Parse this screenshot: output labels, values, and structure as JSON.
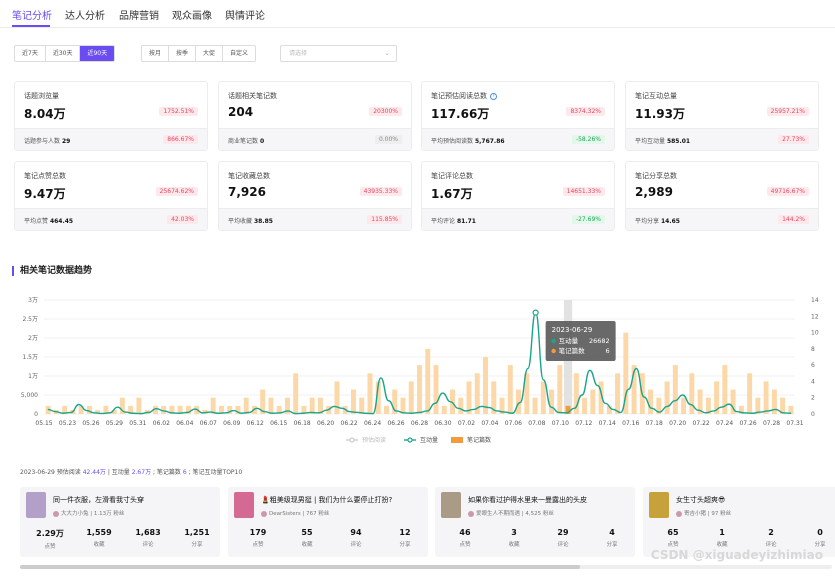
{
  "tabs": [
    {
      "label": "笔记分析",
      "active": true
    },
    {
      "label": "达人分析",
      "active": false
    },
    {
      "label": "品牌营销",
      "active": false
    },
    {
      "label": "观众画像",
      "active": false
    },
    {
      "label": "舆情评论",
      "active": false
    }
  ],
  "range_buttons": [
    "近7天",
    "近30天",
    "近90天"
  ],
  "range_selected": "近90天",
  "period_buttons": [
    "按月",
    "按季",
    "大促",
    "自定义"
  ],
  "select_placeholder": "请选择",
  "cards": [
    {
      "label": "话题浏览量",
      "value": "8.04万",
      "change": "1752.51%",
      "foot_label": "话题参与人数",
      "foot_value": "29",
      "foot_change": "866.67%",
      "foot_type": "pos"
    },
    {
      "label": "话题相关笔记数",
      "value": "204",
      "change": "20300%",
      "foot_label": "商业笔记数",
      "foot_value": "0",
      "foot_change": "0.00%",
      "foot_type": "neu"
    },
    {
      "label": "笔记预估阅读总数",
      "value": "117.66万",
      "change": "8374.32%",
      "info": true,
      "foot_label": "平均预估阅读数",
      "foot_value": "5,767.86",
      "foot_change": "-58.26%",
      "foot_type": "neg"
    },
    {
      "label": "笔记互动总量",
      "value": "11.93万",
      "change": "25957.21%",
      "foot_label": "平均互动量",
      "foot_value": "585.01",
      "foot_change": "27.73%",
      "foot_type": "pos"
    },
    {
      "label": "笔记点赞总数",
      "value": "9.47万",
      "change": "25674.62%",
      "foot_label": "平均点赞",
      "foot_value": "464.45",
      "foot_change": "42.03%",
      "foot_type": "pos"
    },
    {
      "label": "笔记收藏总数",
      "value": "7,926",
      "change": "43935.33%",
      "foot_label": "平均收藏",
      "foot_value": "38.85",
      "foot_change": "115.85%",
      "foot_type": "pos"
    },
    {
      "label": "笔记评论总数",
      "value": "1.67万",
      "change": "14651.33%",
      "foot_label": "平均评论",
      "foot_value": "81.71",
      "foot_change": "-27.69%",
      "foot_type": "neg"
    },
    {
      "label": "笔记分享总数",
      "value": "2,989",
      "change": "49716.67%",
      "foot_label": "平均分享",
      "foot_value": "14.65",
      "foot_change": "144.2%",
      "foot_type": "pos"
    }
  ],
  "section_title": "相关笔记数据趋势",
  "chart_data": {
    "type": "bar",
    "x_ticks": [
      "05.15",
      "05.23",
      "05.26",
      "05.29",
      "05.31",
      "06.02",
      "06.04",
      "06.07",
      "06.09",
      "06.12",
      "06.15",
      "06.18",
      "06.20",
      "06.22",
      "06.24",
      "06.26",
      "06.28",
      "06.30",
      "07.02",
      "07.04",
      "07.06",
      "07.08",
      "07.10",
      "07.12",
      "07.14",
      "07.16",
      "07.18",
      "07.20",
      "07.22",
      "07.24",
      "07.26",
      "07.28",
      "07.31"
    ],
    "y_left_ticks": [
      "0",
      "5,000",
      "1万",
      "1.5万",
      "2万",
      "2.5万",
      "3万"
    ],
    "y_left_lim": [
      0,
      30000
    ],
    "y_right_ticks": [
      "0",
      "2",
      "4",
      "6",
      "8",
      "10",
      "12",
      "14"
    ],
    "y_right_lim": [
      0,
      14
    ],
    "series": [
      {
        "name": "笔记篇数",
        "kind": "bar",
        "axis": "right",
        "color": "#fcd7a8",
        "values": [
          1,
          0.5,
          1,
          0.5,
          1,
          1,
          0.5,
          1,
          0.5,
          2,
          1,
          2,
          0.5,
          1,
          1,
          1,
          1,
          1,
          1,
          0.5,
          2,
          1,
          1,
          1,
          2,
          1,
          3,
          2,
          1,
          2,
          5,
          1,
          2,
          2,
          1,
          4,
          1,
          3,
          2,
          5,
          4,
          1,
          3,
          2,
          4,
          6,
          8,
          6,
          1,
          3,
          2,
          4,
          5,
          7,
          4,
          2,
          6,
          3,
          5,
          2,
          4,
          3,
          6,
          1,
          5,
          2,
          3,
          4,
          1,
          5,
          10,
          6,
          5,
          3,
          2,
          4,
          6,
          2,
          5,
          3,
          2,
          4,
          6,
          3,
          1,
          5,
          2,
          4,
          3,
          2,
          1
        ]
      },
      {
        "name": "互动量",
        "kind": "line",
        "axis": "left",
        "color": "#1aa58a",
        "values": [
          1200,
          600,
          200,
          400,
          2500,
          900,
          300,
          150,
          300,
          1800,
          500,
          200,
          100,
          400,
          1400,
          800,
          300,
          200,
          400,
          1300,
          300,
          500,
          200,
          300,
          900,
          200,
          400,
          1500,
          600,
          200,
          300,
          800,
          100,
          200,
          400,
          300,
          1000,
          2000,
          1500,
          600,
          400,
          200,
          100,
          9500,
          3500,
          800,
          300,
          200,
          400,
          800,
          2800,
          5500,
          3200,
          1500,
          800,
          1200,
          2000,
          1700,
          800,
          500,
          200,
          3000,
          12000,
          26682,
          9000,
          1800,
          400,
          300,
          1500,
          5000,
          11500,
          7500,
          2800,
          1200,
          400,
          6500,
          12000,
          4500,
          1500,
          500,
          2000,
          3500,
          5000,
          2500,
          1000,
          300,
          800,
          1800,
          2600,
          600,
          300,
          200,
          500,
          800,
          1200,
          300,
          200
        ]
      },
      {
        "name": "预估阅读",
        "kind": "line",
        "axis": "left",
        "color": "#cccccc",
        "hidden": true,
        "values": []
      }
    ],
    "highlight": {
      "x": "2023-06-29",
      "label": "2023-06-29",
      "items": [
        {
          "name": "互动量",
          "value": "26682"
        },
        {
          "name": "笔记篇数",
          "value": "6"
        }
      ]
    },
    "legend": {
      "placement": "bottom-center",
      "items": [
        "预估阅读",
        "互动量",
        "笔记篇数"
      ]
    }
  },
  "summary": {
    "date": "2023-06-29",
    "read_label": "预估阅读",
    "read_value": "42.44万",
    "inter_label": "互动量",
    "inter_value": "2.67万",
    "notes_label": "笔记篇数",
    "notes_value": "6",
    "top_label": "笔记互动量TOP10"
  },
  "notes": [
    {
      "title": "同一件衣服，左滑看我寸头穿",
      "author": "大大力小兔",
      "fans": "1.13万 粉丝",
      "thumb": "#b3a0c8",
      "likes": "2.29万",
      "collect": "1,559",
      "comment": "1,683",
      "share": "1,251"
    },
    {
      "title": "💄粗美级现男挺 | 我们为什么要停止打扮?",
      "author": "DearSisters",
      "fans": "767 粉丝",
      "thumb": "#d46a93",
      "likes": "179",
      "collect": "55",
      "comment": "94",
      "share": "12"
    },
    {
      "title": "如果你看过护得水里来一曼露出的头皮",
      "author": "爱眼生人不期而遇",
      "fans": "4,525 粉丝",
      "thumb": "#a99b86",
      "likes": "46",
      "collect": "3",
      "comment": "29",
      "share": "4"
    },
    {
      "title": "女生寸头超爽😎",
      "author": "寄吉小猪",
      "fans": "97 粉丝",
      "thumb": "#c7a23a",
      "likes": "65",
      "collect": "1",
      "comment": "2",
      "share": "0"
    }
  ],
  "stat_labels": {
    "likes": "点赞",
    "collect": "收藏",
    "comment": "评论",
    "share": "分享"
  },
  "watermark": "CSDN @xiguadeyizhimiao"
}
